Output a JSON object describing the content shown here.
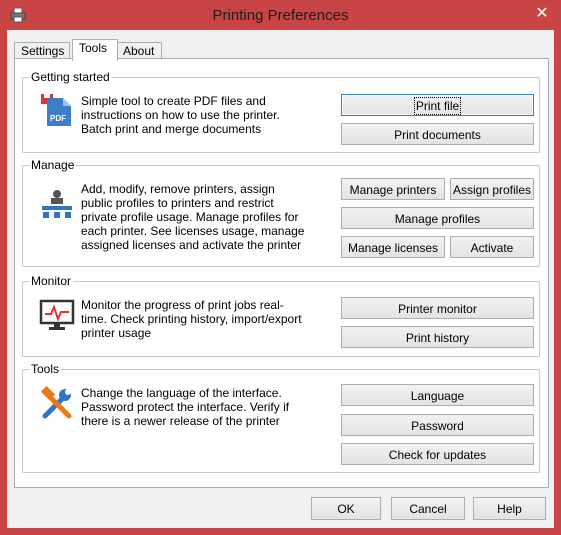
{
  "window": {
    "title": "Printing Preferences",
    "close_glyph": "✕"
  },
  "tabs": [
    {
      "label": "Settings"
    },
    {
      "label": "Tools"
    },
    {
      "label": "About"
    }
  ],
  "groups": {
    "getting_started": {
      "title": "Getting started",
      "description": "Simple tool to create PDF files and instructions on how to use the printer. Batch print and merge documents",
      "icon": "pdf-file-icon",
      "buttons": {
        "print_file": "Print file",
        "print_documents": "Print documents"
      }
    },
    "manage": {
      "title": "Manage",
      "description": "Add, modify, remove printers, assign public profiles to printers and restrict private profile usage. Manage profiles for each printer. See licenses usage, manage assigned licenses and activate the printer",
      "icon": "network-tree-icon",
      "buttons": {
        "manage_printers": "Manage printers",
        "assign_profiles": "Assign profiles",
        "manage_profiles": "Manage profiles",
        "manage_licenses": "Manage licenses",
        "activate": "Activate"
      }
    },
    "monitor": {
      "title": "Monitor",
      "description": "Monitor the progress of print jobs real-time. Check printing history, import/export printer usage",
      "icon": "monitor-chart-icon",
      "buttons": {
        "printer_monitor": "Printer monitor",
        "print_history": "Print history"
      }
    },
    "tools": {
      "title": "Tools",
      "description": "Change the language of the interface. Password protect the interface. Verify if there is a newer release of the printer",
      "icon": "wrench-hammer-icon",
      "buttons": {
        "language": "Language",
        "password": "Password",
        "check_updates": "Check for updates"
      }
    }
  },
  "footer": {
    "ok": "OK",
    "cancel": "Cancel",
    "help": "Help"
  }
}
